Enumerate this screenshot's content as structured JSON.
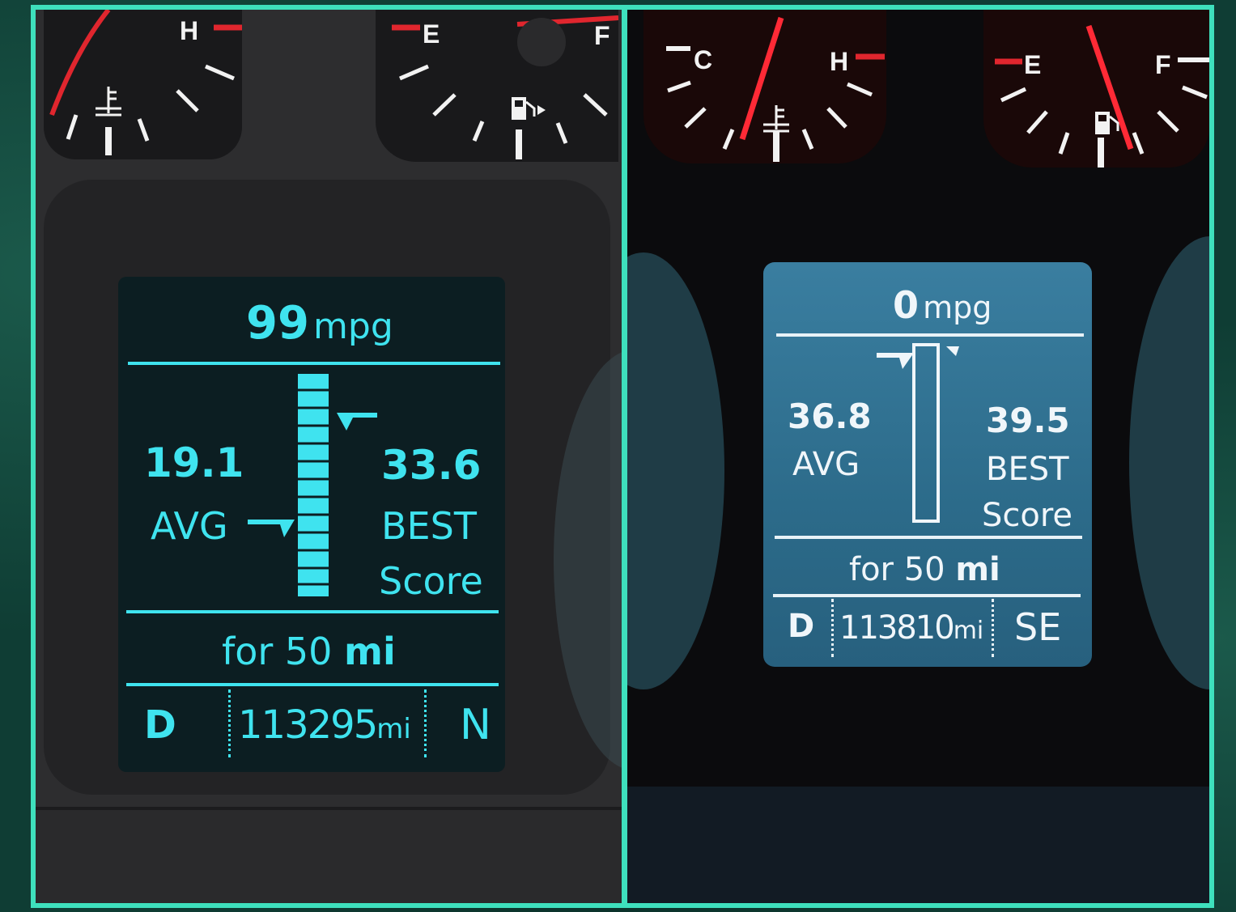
{
  "left_cluster": {
    "temp_gauge": {
      "hot_label": "H"
    },
    "fuel_gauge": {
      "empty_label": "E",
      "full_label": "F"
    },
    "display": {
      "instant_mpg_value": "99",
      "instant_mpg_unit": "mpg",
      "avg_value": "19.1",
      "avg_label": "AVG",
      "best_value": "33.6",
      "best_label": "BEST",
      "score_label": "Score",
      "for_label": "for 50",
      "distance_unit": "mi",
      "gear": "D",
      "odometer_value": "113295",
      "odometer_unit": "mi",
      "heading": "N"
    }
  },
  "right_cluster": {
    "temp_gauge": {
      "cold_label": "C",
      "hot_label": "H"
    },
    "fuel_gauge": {
      "empty_label": "E",
      "full_label": "F"
    },
    "display": {
      "instant_mpg_value": "0",
      "instant_mpg_unit": "mpg",
      "avg_value": "36.8",
      "avg_label": "AVG",
      "best_value": "39.5",
      "best_label": "BEST",
      "score_label": "Score",
      "for_label": "for 50",
      "distance_unit": "mi",
      "gear": "D",
      "odometer_value": "113810",
      "odometer_unit": "mi",
      "heading": "SE"
    }
  },
  "colors": {
    "frame_border": "#3ee0bd",
    "background": "#0f3d34",
    "lcd_dark_text": "#3fe3ef",
    "lcd_blue_bg": "#2f6f8f",
    "needle_red": "#e0262e"
  }
}
